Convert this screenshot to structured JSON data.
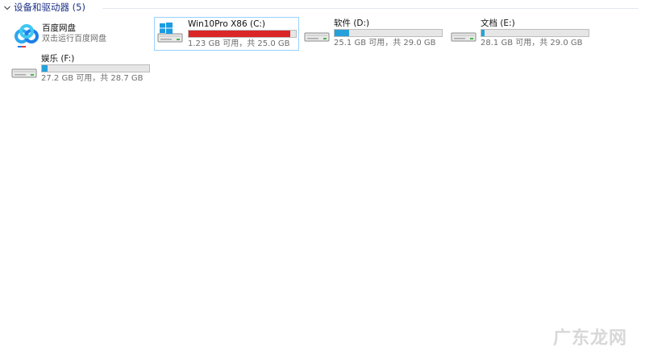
{
  "group": {
    "title": "设备和驱动器 (5)"
  },
  "baidu": {
    "name": "百度网盘",
    "subtitle": "双击运行百度网盘"
  },
  "drives": [
    {
      "name": "Win10Pro X86 (C:)",
      "space": "1.23 GB 可用，共 25.0 GB",
      "used_fraction": 0.951,
      "bar_color": "#da2626",
      "has_windows_logo": true
    },
    {
      "name": "软件 (D:)",
      "space": "25.1 GB 可用，共 29.0 GB",
      "used_fraction": 0.134,
      "bar_color": "#26a0da",
      "has_windows_logo": false
    },
    {
      "name": "文档 (E:)",
      "space": "28.1 GB 可用，共 29.0 GB",
      "used_fraction": 0.031,
      "bar_color": "#26a0da",
      "has_windows_logo": false
    },
    {
      "name": "娱乐 (F:)",
      "space": "27.2 GB 可用，共 28.7 GB",
      "used_fraction": 0.052,
      "bar_color": "#26a0da",
      "has_windows_logo": false
    }
  ],
  "watermark": "广东龙网",
  "icons": {
    "expand": "chevron-down-icon",
    "baidu": "baidu-netdisk-icon",
    "drive": "hard-drive-icon",
    "windows": "windows-logo-icon"
  }
}
